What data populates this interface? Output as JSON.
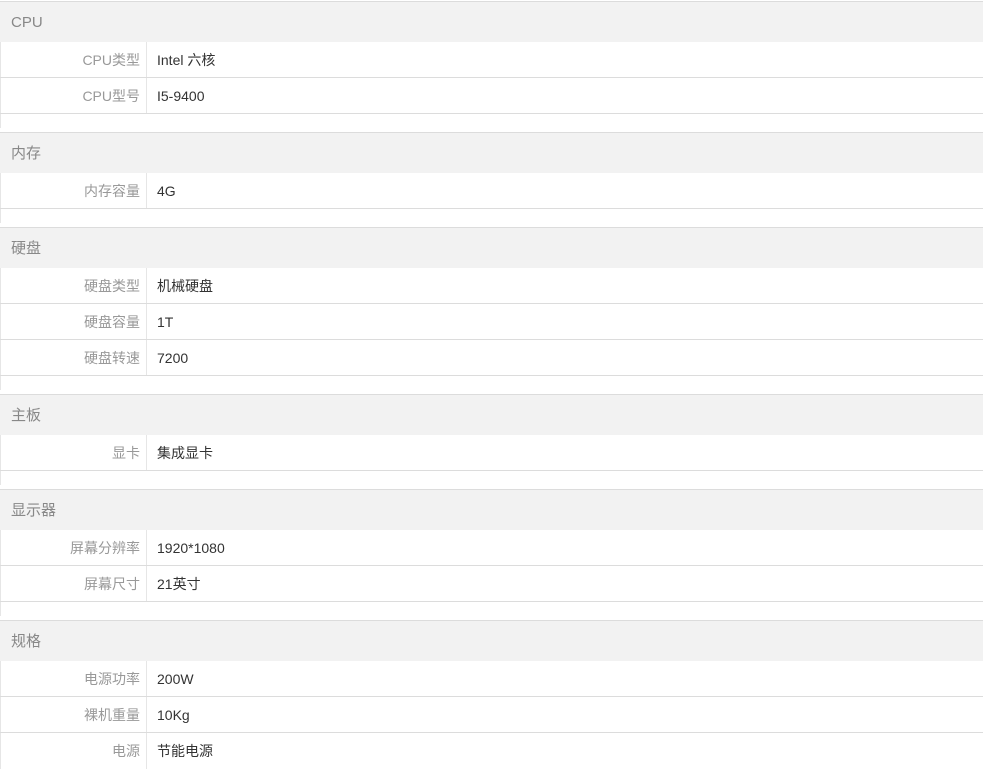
{
  "sections": [
    {
      "title": "CPU",
      "rows": [
        {
          "key": "CPU类型",
          "value": "Intel 六核"
        },
        {
          "key": "CPU型号",
          "value": "I5-9400"
        }
      ]
    },
    {
      "title": "内存",
      "rows": [
        {
          "key": "内存容量",
          "value": "4G"
        }
      ]
    },
    {
      "title": "硬盘",
      "rows": [
        {
          "key": "硬盘类型",
          "value": "机械硬盘"
        },
        {
          "key": "硬盘容量",
          "value": "1T"
        },
        {
          "key": "硬盘转速",
          "value": "7200"
        }
      ]
    },
    {
      "title": "主板",
      "rows": [
        {
          "key": "显卡",
          "value": "集成显卡"
        }
      ]
    },
    {
      "title": "显示器",
      "rows": [
        {
          "key": "屏幕分辨率",
          "value": "1920*1080"
        },
        {
          "key": "屏幕尺寸",
          "value": "21英寸"
        }
      ]
    },
    {
      "title": "规格",
      "rows": [
        {
          "key": "电源功率",
          "value": "200W"
        },
        {
          "key": "裸机重量",
          "value": "10Kg"
        },
        {
          "key": "电源",
          "value": "节能电源"
        }
      ]
    }
  ]
}
